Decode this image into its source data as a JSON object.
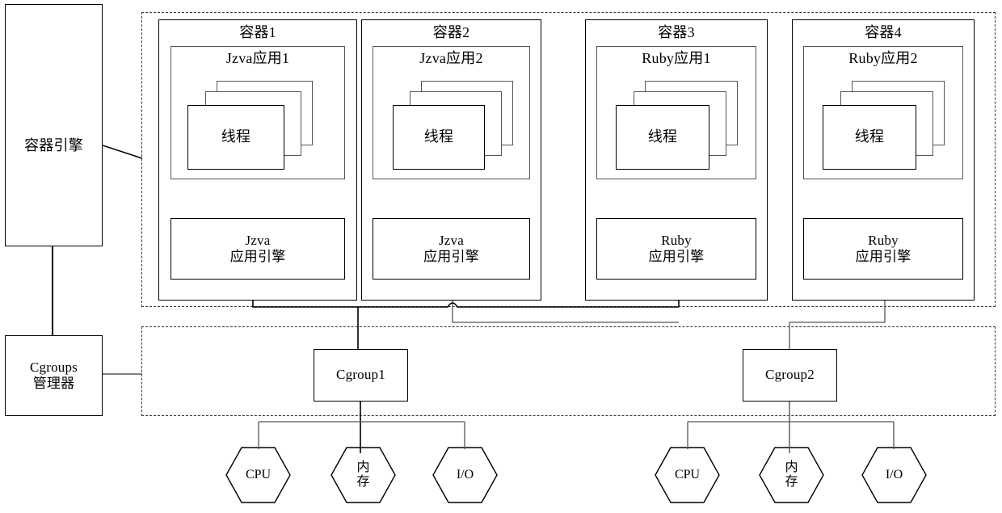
{
  "diagram": {
    "title": "Container engine and Cgroups resource allocation diagram",
    "colors": {
      "stroke_dark": "#000000",
      "stroke_gray": "#555555",
      "dashed": "#333333",
      "background": "#ffffff"
    }
  },
  "left_column": {
    "container_engine": {
      "label": "容器引擎"
    },
    "cgroups_manager": {
      "label": "Cgroups\n管理器"
    }
  },
  "container_zone": {
    "containers": [
      {
        "title": "容器1",
        "app": {
          "label": "Jzva应用1"
        },
        "thread": {
          "label": "线程"
        },
        "engine": {
          "label": "Jzva\n应用引擎"
        }
      },
      {
        "title": "容器2",
        "app": {
          "label": "Jzva应用2"
        },
        "thread": {
          "label": "线程"
        },
        "engine": {
          "label": "Jzva\n应用引擎"
        }
      },
      {
        "title": "容器3",
        "app": {
          "label": "Ruby应用1"
        },
        "thread": {
          "label": "线程"
        },
        "engine": {
          "label": "Ruby\n应用引擎"
        }
      },
      {
        "title": "容器4",
        "app": {
          "label": "Ruby应用2"
        },
        "thread": {
          "label": "线程"
        },
        "engine": {
          "label": "Ruby\n应用引擎"
        }
      }
    ]
  },
  "cgroup_zone": {
    "cgroups": [
      {
        "label": "Cgroup1"
      },
      {
        "label": "Cgroup2"
      }
    ]
  },
  "resources": {
    "group1": [
      {
        "label": "CPU"
      },
      {
        "label": "内\n存"
      },
      {
        "label": "I/O"
      }
    ],
    "group2": [
      {
        "label": "CPU"
      },
      {
        "label": "内\n存"
      },
      {
        "label": "I/O"
      }
    ]
  }
}
